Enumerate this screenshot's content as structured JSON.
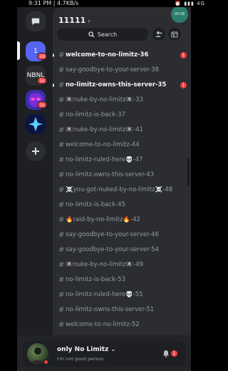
{
  "statusbar": {
    "time": "9:31 PM | 4.7KB/s",
    "right": "⏰ ▮▮▮ 4G"
  },
  "rail": {
    "servers": [
      {
        "label": "1",
        "badge": "28",
        "color": "#5865f2"
      },
      {
        "label": "NBNL",
        "badge": "1k",
        "color": "#2b2d31"
      },
      {
        "label": "",
        "badge": "1k",
        "color": "#2a2a8a"
      },
      {
        "label": "",
        "badge": "",
        "color": "#1c2a6e"
      }
    ]
  },
  "guild": {
    "name": "11111",
    "call_time": "00:58"
  },
  "search": {
    "label": "Search"
  },
  "channels": [
    {
      "name": "welcome-to-no-limitz-36",
      "unread": true,
      "badge": "1"
    },
    {
      "name": "say-goodbye-to-your-server-38",
      "unread": false,
      "badge": ""
    },
    {
      "name": "no-limitz-owns-this-server-35",
      "unread": true,
      "badge": "1"
    },
    {
      "name": "🏴‍☠️nuke-by-no-limitz🏴‍☠️-33",
      "unread": false,
      "badge": ""
    },
    {
      "name": "no-limitz-is-back-37",
      "unread": false,
      "badge": ""
    },
    {
      "name": "🏴‍☠️nuke-by-no-limitz🏴‍☠️-41",
      "unread": false,
      "badge": ""
    },
    {
      "name": "welcome-to-no-limitz-44",
      "unread": false,
      "badge": ""
    },
    {
      "name": "no-limitz-ruled-here💀-47",
      "unread": false,
      "badge": ""
    },
    {
      "name": "no-limitz-owns-this-server-43",
      "unread": false,
      "badge": ""
    },
    {
      "name": "☠️you-got-nuked-by-no-limitz☠️-48",
      "unread": false,
      "badge": ""
    },
    {
      "name": "no-limitz-is-back-45",
      "unread": false,
      "badge": ""
    },
    {
      "name": "🔥raid-by-no-limitz🔥-42",
      "unread": false,
      "badge": ""
    },
    {
      "name": "say-goodbye-to-your-server-46",
      "unread": false,
      "badge": ""
    },
    {
      "name": "say-goodbye-to-your-server-54",
      "unread": false,
      "badge": ""
    },
    {
      "name": "🏴‍☠️nuke-by-no-limitz🏴‍☠️-49",
      "unread": false,
      "badge": ""
    },
    {
      "name": "no-limitz-is-back-53",
      "unread": false,
      "badge": ""
    },
    {
      "name": "no-limitz-ruled-here💀-55",
      "unread": false,
      "badge": ""
    },
    {
      "name": "no-limitz-owns-this-server-51",
      "unread": false,
      "badge": ""
    },
    {
      "name": "welcome-to-no-limitz-52",
      "unread": false,
      "badge": ""
    }
  ],
  "user": {
    "name": "only No Limitz",
    "status": "I'm not good person",
    "notif_badge": "1"
  },
  "colors": {
    "accent": "#5865f2",
    "danger": "#f23f43",
    "panel": "#2b2d31",
    "rail": "#1e1f22"
  }
}
